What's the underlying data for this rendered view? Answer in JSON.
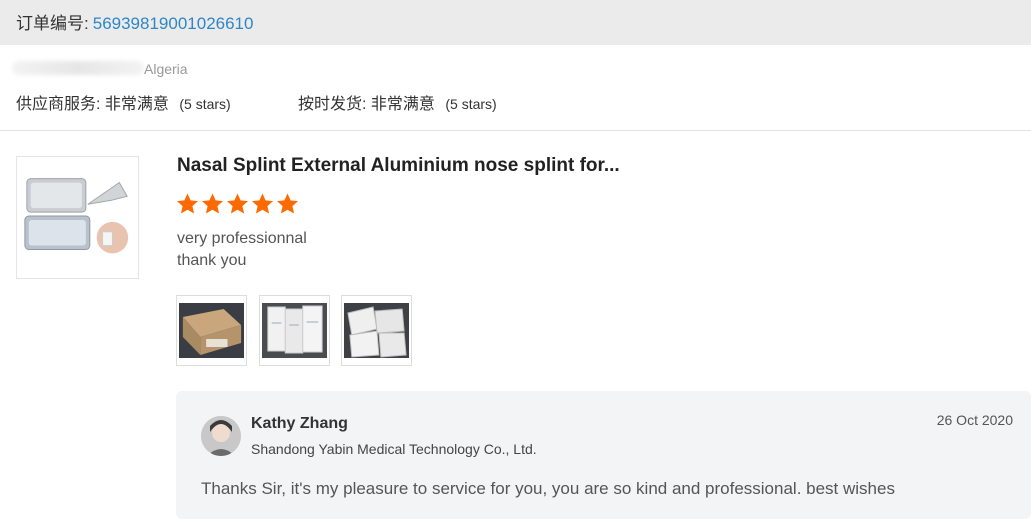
{
  "order": {
    "label": "订单编号:",
    "number": "56939819001026610"
  },
  "buyer": {
    "country": "Algeria"
  },
  "ratings": {
    "supplier_label": "供应商服务:",
    "supplier_value": "非常满意",
    "supplier_stars": "(5 stars)",
    "shipping_label": "按时发货:",
    "shipping_value": "非常满意",
    "shipping_stars": "(5 stars)"
  },
  "review": {
    "product_title": "Nasal Splint External Aluminium nose splint for...",
    "star_rating": 5,
    "star_color": "#ff6a00",
    "line1": "very professionnal",
    "line2": "thank you",
    "photos": [
      "box-photo",
      "packets-photo",
      "packets-closeup-photo"
    ]
  },
  "reply": {
    "name": "Kathy Zhang",
    "company": "Shandong Yabin Medical Technology Co., Ltd.",
    "date": "26 Oct 2020",
    "text": "Thanks Sir, it's my pleasure to service for you, you are so kind and professional. best wishes"
  }
}
